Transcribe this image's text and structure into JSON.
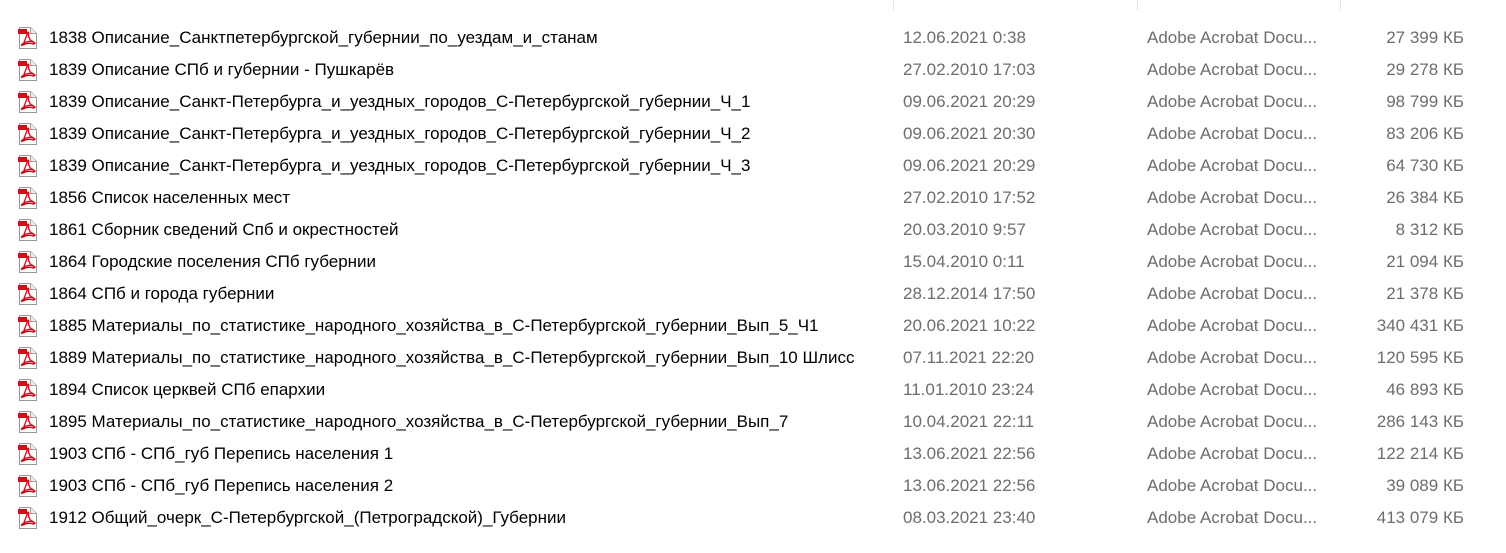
{
  "colors": {
    "name_text": "#000000",
    "meta_text": "#6d6d6d",
    "pdf_icon_red": "#c8101e",
    "divider": "#e5e5e5"
  },
  "row_icon": "pdf-file-icon",
  "files": [
    {
      "name": "1838 Описание_Санктпетербургской_губернии_по_уездам_и_станам",
      "date": "12.06.2021 0:38",
      "type": "Adobe Acrobat Docu...",
      "size": "27 399 КБ"
    },
    {
      "name": "1839 Описание СПб и губернии - Пушкарёв",
      "date": "27.02.2010 17:03",
      "type": "Adobe Acrobat Docu...",
      "size": "29 278 КБ"
    },
    {
      "name": "1839 Описание_Санкт-Петербурга_и_уездных_городов_С-Петербургской_губернии_Ч_1",
      "date": "09.06.2021 20:29",
      "type": "Adobe Acrobat Docu...",
      "size": "98 799 КБ"
    },
    {
      "name": "1839 Описание_Санкт-Петербурга_и_уездных_городов_С-Петербургской_губернии_Ч_2",
      "date": "09.06.2021 20:30",
      "type": "Adobe Acrobat Docu...",
      "size": "83 206 КБ"
    },
    {
      "name": "1839 Описание_Санкт-Петербурга_и_уездных_городов_С-Петербургской_губернии_Ч_3",
      "date": "09.06.2021 20:29",
      "type": "Adobe Acrobat Docu...",
      "size": "64 730 КБ"
    },
    {
      "name": "1856 Список населенных мест",
      "date": "27.02.2010 17:52",
      "type": "Adobe Acrobat Docu...",
      "size": "26 384 КБ"
    },
    {
      "name": "1861 Сборник сведений Спб и окрестностей",
      "date": "20.03.2010 9:57",
      "type": "Adobe Acrobat Docu...",
      "size": "8 312 КБ"
    },
    {
      "name": "1864 Городские поселения СПб губернии",
      "date": "15.04.2010 0:11",
      "type": "Adobe Acrobat Docu...",
      "size": "21 094 КБ"
    },
    {
      "name": "1864 СПб и города губернии",
      "date": "28.12.2014 17:50",
      "type": "Adobe Acrobat Docu...",
      "size": "21 378 КБ"
    },
    {
      "name": "1885 Материалы_по_статистике_народного_хозяйства_в_С-Петербургской_губернии_Вып_5_Ч1",
      "date": "20.06.2021 10:22",
      "type": "Adobe Acrobat Docu...",
      "size": "340 431 КБ"
    },
    {
      "name": "1889 Материалы_по_статистике_народного_хозяйства_в_С-Петербургской_губернии_Вып_10 Шлисс",
      "date": "07.11.2021 22:20",
      "type": "Adobe Acrobat Docu...",
      "size": "120 595 КБ"
    },
    {
      "name": "1894 Список церквей СПб епархии",
      "date": "11.01.2010 23:24",
      "type": "Adobe Acrobat Docu...",
      "size": "46 893 КБ"
    },
    {
      "name": "1895 Материалы_по_статистике_народного_хозяйства_в_С-Петербургской_губернии_Вып_7",
      "date": "10.04.2021 22:11",
      "type": "Adobe Acrobat Docu...",
      "size": "286 143 КБ"
    },
    {
      "name": "1903 СПб - СПб_губ Перепись населения 1",
      "date": "13.06.2021 22:56",
      "type": "Adobe Acrobat Docu...",
      "size": "122 214 КБ"
    },
    {
      "name": "1903 СПб - СПб_губ Перепись населения 2",
      "date": "13.06.2021 22:56",
      "type": "Adobe Acrobat Docu...",
      "size": "39 089 КБ"
    },
    {
      "name": "1912 Общий_очерк_С-Петербургской_(Петроградской)_Губернии",
      "date": "08.03.2021 23:40",
      "type": "Adobe Acrobat Docu...",
      "size": "413 079 КБ"
    }
  ]
}
